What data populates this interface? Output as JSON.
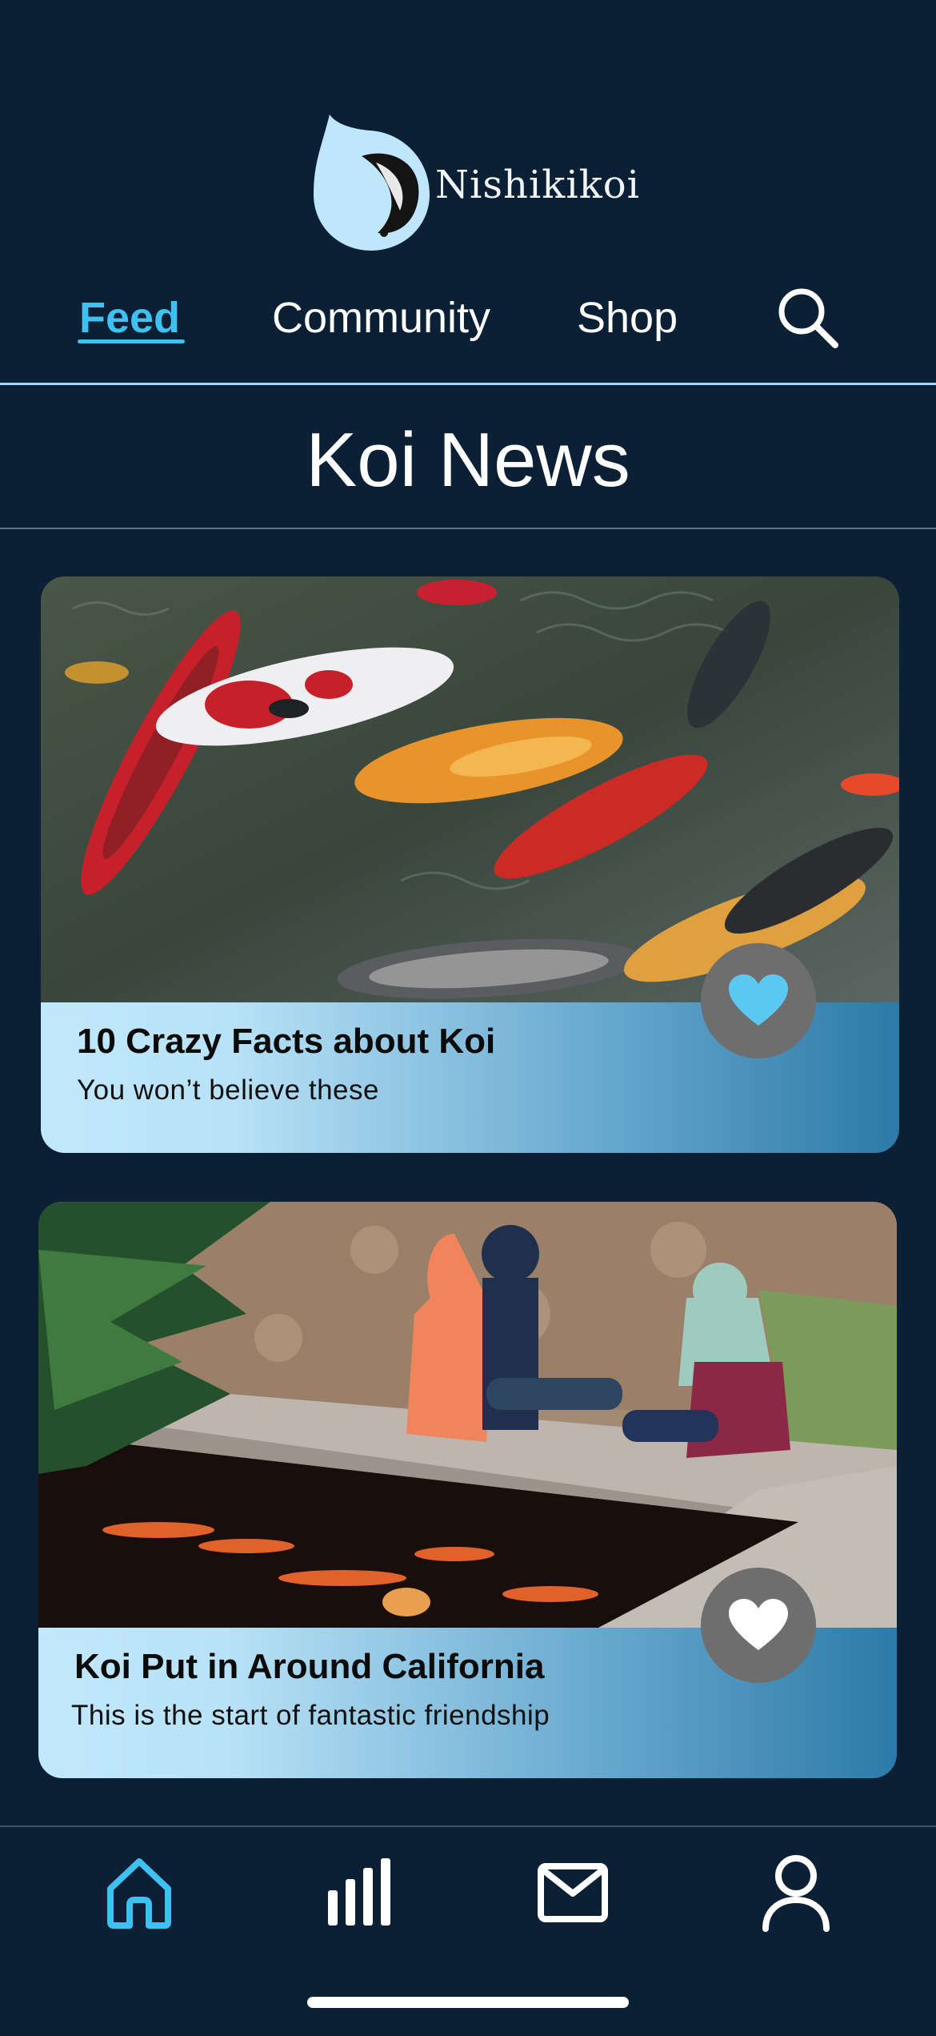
{
  "app": {
    "brand_name": "Nishikikoi",
    "logo_icon": "koi-drop-logo"
  },
  "nav": {
    "tabs": [
      {
        "label": "Feed",
        "active": true
      },
      {
        "label": "Community",
        "active": false
      },
      {
        "label": "Shop",
        "active": false
      }
    ],
    "search_icon": "search-icon"
  },
  "page": {
    "title": "Koi News"
  },
  "cards": [
    {
      "title": "10 Crazy Facts about Koi",
      "subtitle": "You won’t believe these",
      "image": "photo of koi fish swimming in pond",
      "liked": true,
      "like_icon": "heart-icon"
    },
    {
      "title": "Koi Put in Around California",
      "subtitle": "This is the start of fantastic friendship",
      "image": "photo of two women sitting by koi pond",
      "liked": false,
      "like_icon": "heart-icon"
    }
  ],
  "tabbar": {
    "items": [
      {
        "icon": "home-icon",
        "active": true
      },
      {
        "icon": "stats-icon",
        "active": false
      },
      {
        "icon": "mail-icon",
        "active": false
      },
      {
        "icon": "profile-icon",
        "active": false
      }
    ]
  },
  "colors": {
    "background": "#0b2035",
    "accent": "#3ec0f0",
    "divider": "#9fd8f5",
    "like_active": "#5cc8f2",
    "like_inactive": "#ffffff",
    "like_button_bg": "#6e6e6e"
  }
}
